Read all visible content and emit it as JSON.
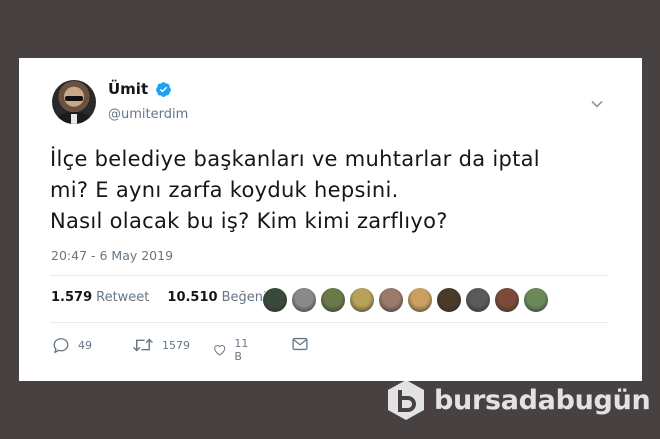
{
  "tweet": {
    "author_name": "Ümit",
    "handle": "@umiterdim",
    "verified": true,
    "text_lines": [
      "İlçe belediye başkanları ve muhtarlar da iptal",
      "mi? E aynı zarfa koyduk hepsini.",
      "Nasıl olacak bu iş? Kim kimi zarflıyo?"
    ],
    "timestamp": "20:47 - 6 May 2019"
  },
  "stats": {
    "retweet_count": "1.579",
    "retweet_label": "Retweet",
    "like_count": "10.510",
    "like_label": "Beğeni",
    "liker_avatar_colors": [
      "#3a4a3a",
      "#8a8a8a",
      "#6a7a4a",
      "#b7a15a",
      "#9a7a6a",
      "#c8a060",
      "#4a3a2a",
      "#5a5a5a",
      "#7a4a3a",
      "#6a8a5a"
    ]
  },
  "actions": {
    "reply_count": "49",
    "retweet_count": "1579",
    "like_count": "11 B"
  },
  "icons": {
    "verified": "verified-badge-icon",
    "menu": "chevron-down-icon",
    "reply": "reply-icon",
    "retweet": "retweet-icon",
    "like": "heart-icon",
    "dm": "envelope-icon"
  },
  "watermark": {
    "text": "bursadabugün"
  },
  "colors": {
    "background": "#484141",
    "verified_blue": "#1da1f2",
    "muted": "#657786"
  }
}
